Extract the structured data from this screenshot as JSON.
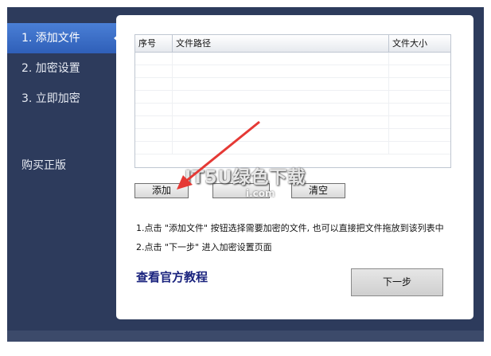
{
  "sidebar": {
    "items": [
      {
        "label": "1. 添加文件"
      },
      {
        "label": "2. 加密设置"
      },
      {
        "label": "3. 立即加密"
      }
    ],
    "purchase_label": "购买正版"
  },
  "file_table": {
    "headers": [
      "序号",
      "文件路径",
      "文件大小"
    ]
  },
  "buttons": {
    "add_label": "添加",
    "clear_label": "清空",
    "next_label": "下一步"
  },
  "hints": [
    "1.点击 \"添加文件\" 按钮选择需要加密的文件, 也可以直接把文件拖放到该列表中",
    "2.点击 \"下一步\" 进入加密设置页面"
  ],
  "tutorial_link": "查看官方教程",
  "watermark": {
    "main": "IT5U绿色下载",
    "sub": "i.com"
  },
  "colors": {
    "sidebar_bg": "#2d3b5c",
    "active_item": "#3f72cc",
    "link": "#1a237e",
    "arrow": "#e53935"
  }
}
